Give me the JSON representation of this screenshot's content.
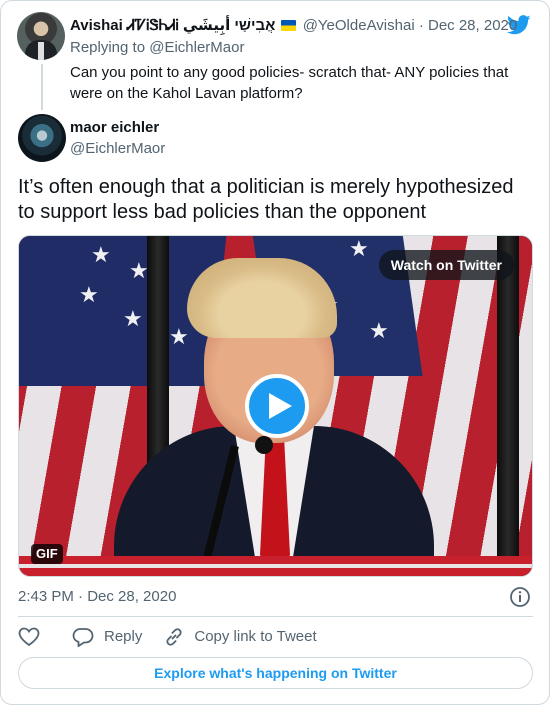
{
  "parent_tweet": {
    "author_name": "Avishai ᏗᏤᎥᏕᏂᏗᎥ אֲבִישַׁי أبِيشَي",
    "author_handle": "@YeOldeAvishai",
    "date": "Dec 28, 2020",
    "separator": "·",
    "replying_prefix": "Replying to",
    "replying_to": "@EichlerMaor",
    "text": "Can you point to any good policies- scratch that- ANY policies that were on the Kahol Lavan platform?"
  },
  "main_tweet": {
    "author_name": "maor eichler",
    "author_handle": "@EichlerMaor",
    "text": "It’s often enough that a politician is merely hypothesized to support less bad policies than the opponent",
    "media": {
      "watch_label": "Watch on Twitter",
      "gif_badge": "GIF"
    },
    "timestamp": "2:43 PM · Dec 28, 2020"
  },
  "actions": {
    "reply_label": "Reply",
    "copy_link_label": "Copy link to Tweet"
  },
  "explore_label": "Explore what's happening on Twitter",
  "icons": [
    "twitter-logo-icon",
    "ukraine-flag-icon",
    "play-icon",
    "info-icon",
    "heart-icon",
    "reply-icon",
    "link-icon"
  ],
  "colors": {
    "accent": "#1d9bf0",
    "secondary_text": "#536471",
    "primary_text": "#0f1419",
    "border": "#cfd9de"
  }
}
